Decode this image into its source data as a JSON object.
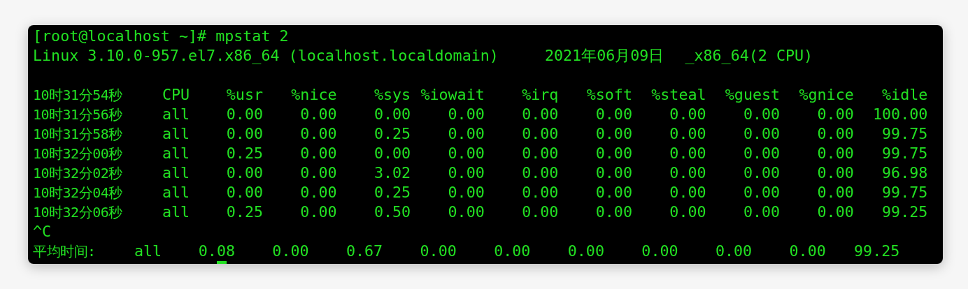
{
  "terminal": {
    "command_line": "[root@localhost ~]# mpstat 2",
    "system_info": {
      "kernel": "Linux 3.10.0-957.el7.x86_64 (localhost.localdomain)",
      "date": "2021年06月09日",
      "arch": "_x86_64(2 CPU)"
    },
    "table": {
      "header": {
        "time": "10时31分54秒",
        "cpu": "CPU",
        "columns": [
          "%usr",
          "%nice",
          "%sys",
          "%iowait",
          "%irq",
          "%soft",
          "%steal",
          "%guest",
          "%gnice",
          "%idle"
        ]
      },
      "rows": [
        {
          "time": "10时31分56秒",
          "cpu": "all",
          "values": [
            "0.00",
            "0.00",
            "0.00",
            "0.00",
            "0.00",
            "0.00",
            "0.00",
            "0.00",
            "0.00",
            "100.00"
          ]
        },
        {
          "time": "10时31分58秒",
          "cpu": "all",
          "values": [
            "0.00",
            "0.00",
            "0.25",
            "0.00",
            "0.00",
            "0.00",
            "0.00",
            "0.00",
            "0.00",
            "99.75"
          ]
        },
        {
          "time": "10时32分00秒",
          "cpu": "all",
          "values": [
            "0.25",
            "0.00",
            "0.00",
            "0.00",
            "0.00",
            "0.00",
            "0.00",
            "0.00",
            "0.00",
            "99.75"
          ]
        },
        {
          "time": "10时32分02秒",
          "cpu": "all",
          "values": [
            "0.00",
            "0.00",
            "3.02",
            "0.00",
            "0.00",
            "0.00",
            "0.00",
            "0.00",
            "0.00",
            "96.98"
          ]
        },
        {
          "time": "10时32分04秒",
          "cpu": "all",
          "values": [
            "0.00",
            "0.00",
            "0.25",
            "0.00",
            "0.00",
            "0.00",
            "0.00",
            "0.00",
            "0.00",
            "99.75"
          ]
        },
        {
          "time": "10时32分06秒",
          "cpu": "all",
          "values": [
            "0.25",
            "0.00",
            "0.50",
            "0.00",
            "0.00",
            "0.00",
            "0.00",
            "0.00",
            "0.00",
            "99.25"
          ]
        }
      ]
    },
    "interrupt": "^C",
    "average": {
      "label": "平均时间:",
      "cpu": "all",
      "values": [
        "0.08",
        "0.00",
        "0.67",
        "0.00",
        "0.00",
        "0.00",
        "0.00",
        "0.00",
        "0.00",
        "99.25"
      ]
    }
  }
}
